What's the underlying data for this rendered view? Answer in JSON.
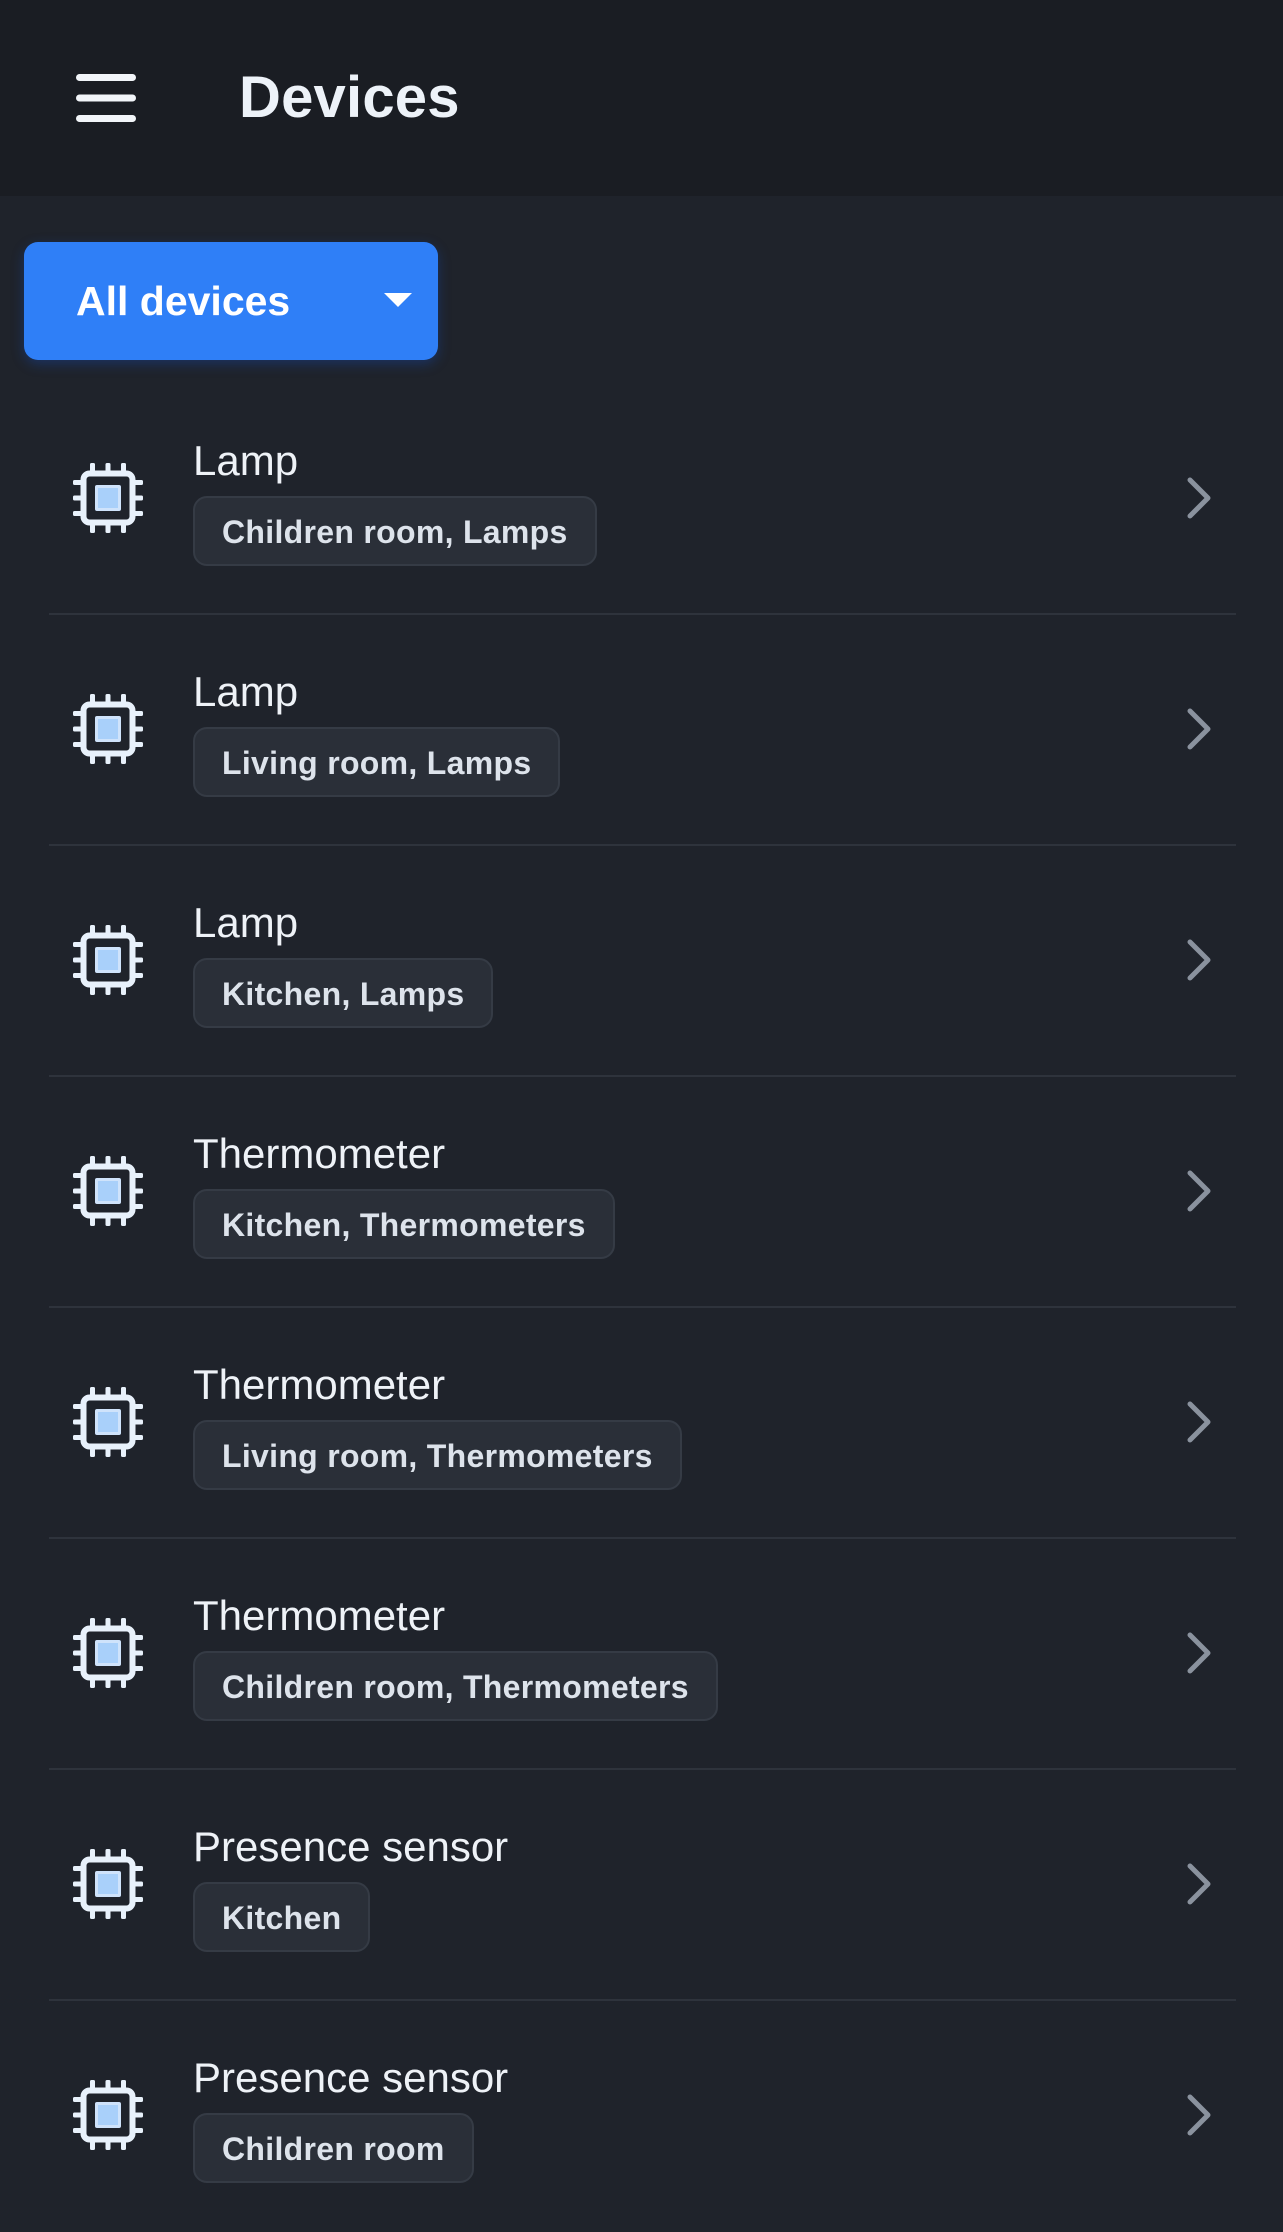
{
  "header": {
    "title": "Devices"
  },
  "filter": {
    "selected": "All devices"
  },
  "devices": [
    {
      "name": "Lamp",
      "tags": "Children room, Lamps"
    },
    {
      "name": "Lamp",
      "tags": "Living room, Lamps"
    },
    {
      "name": "Lamp",
      "tags": "Kitchen, Lamps"
    },
    {
      "name": "Thermometer",
      "tags": "Kitchen, Thermometers"
    },
    {
      "name": "Thermometer",
      "tags": "Living room, Thermometers"
    },
    {
      "name": "Thermometer",
      "tags": "Children room, Thermometers"
    },
    {
      "name": "Presence sensor",
      "tags": "Kitchen"
    },
    {
      "name": "Presence sensor",
      "tags": "Children room"
    }
  ],
  "icons": {
    "menu": "hamburger-menu-icon",
    "device": "chip-icon",
    "row_action": "chevron-right-icon",
    "dropdown": "caret-down-icon"
  },
  "colors": {
    "background": "#1f232b",
    "header_background": "#1a1d23",
    "accent": "#2f7ff7",
    "badge_background": "#2a2f38"
  }
}
